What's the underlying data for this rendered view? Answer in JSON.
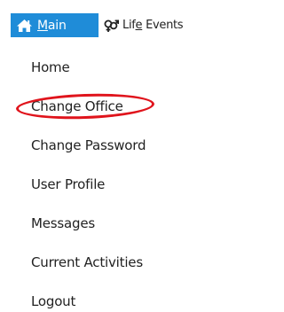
{
  "tabs": {
    "main": {
      "label_pre": "",
      "label_mnemonic": "M",
      "label_post": "ain",
      "icon": "home-icon"
    },
    "life_events": {
      "label_pre": "Lif",
      "label_mnemonic": "e",
      "label_post": " Events",
      "icon": "gender-icon"
    }
  },
  "menu": {
    "items": [
      {
        "label": "Home"
      },
      {
        "label": "Change Office"
      },
      {
        "label": "Change Password"
      },
      {
        "label": "User Profile"
      },
      {
        "label": "Messages"
      },
      {
        "label": "Current Activities"
      },
      {
        "label": "Logout"
      }
    ]
  },
  "colors": {
    "tab_active_bg": "#1f8cd8",
    "highlight": "#e0141c",
    "text": "#222222"
  }
}
